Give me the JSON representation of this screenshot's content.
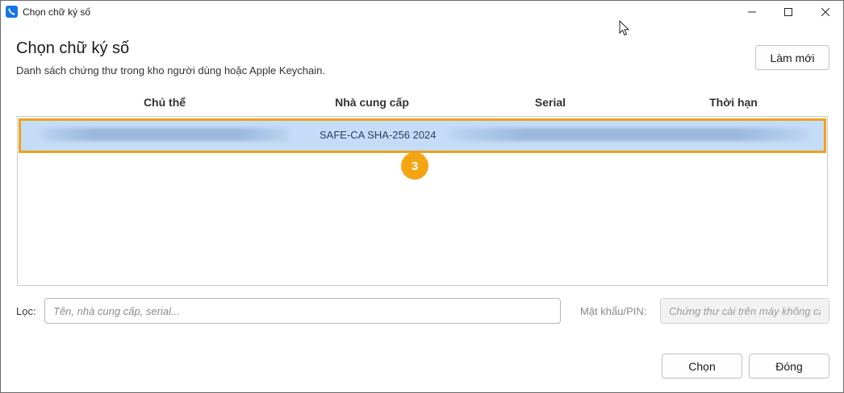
{
  "window": {
    "title": "Chọn chữ ký số",
    "icon": "phone-app-icon",
    "controls": [
      "minimize-icon",
      "maximize-icon",
      "close-icon"
    ]
  },
  "header": {
    "title": "Chọn chữ ký số",
    "subtitle": "Danh sách chứng thư trong kho người dùng hoặc Apple Keychain.",
    "refresh_label": "Làm mới"
  },
  "table": {
    "columns": [
      "Chủ thể",
      "Nhà cung cấp",
      "Serial",
      "Thời hạn"
    ],
    "rows": [
      {
        "subject": "",
        "provider": "SAFE-CA SHA-256 2024",
        "serial": "",
        "expiry": "",
        "selected": true
      }
    ]
  },
  "step_badge": "3",
  "filter": {
    "label": "Lọc:",
    "placeholder": "Tên, nhà cung cấp, serial...",
    "value": ""
  },
  "pin": {
    "label": "Mật khẩu/PIN:",
    "placeholder": "Chứng thư cài trên máy không cần PIN",
    "disabled": true
  },
  "footer": {
    "select_label": "Chọn",
    "close_label": "Đóng"
  },
  "colors": {
    "selection_bg": "#c5dcf6",
    "highlight_border": "#f0a11c",
    "badge": "#f5a414",
    "app_icon": "#1a73e8"
  }
}
